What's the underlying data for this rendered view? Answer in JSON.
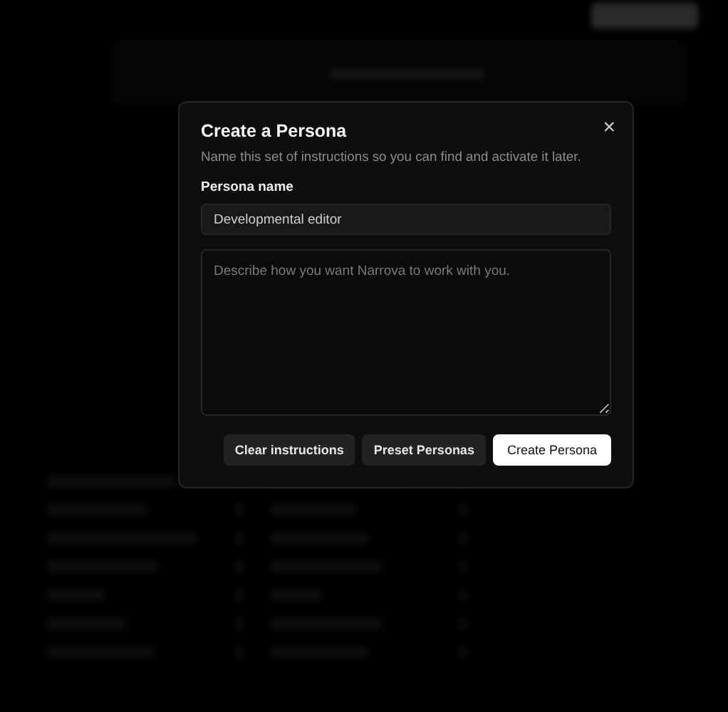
{
  "dialog": {
    "title": "Create a Persona",
    "description": "Name this set of instructions so you can find and activate it later.",
    "close": "×",
    "name_field": {
      "label": "Persona name",
      "value": "Developmental editor"
    },
    "instructions_field": {
      "placeholder": "Describe how you want Narrova to work with you."
    },
    "buttons": [
      {
        "label": "Clear instructions",
        "kind": "secondary"
      },
      {
        "label": "Preset Personas",
        "kind": "secondary"
      },
      {
        "label": "Create Persona",
        "kind": "primary"
      }
    ]
  }
}
